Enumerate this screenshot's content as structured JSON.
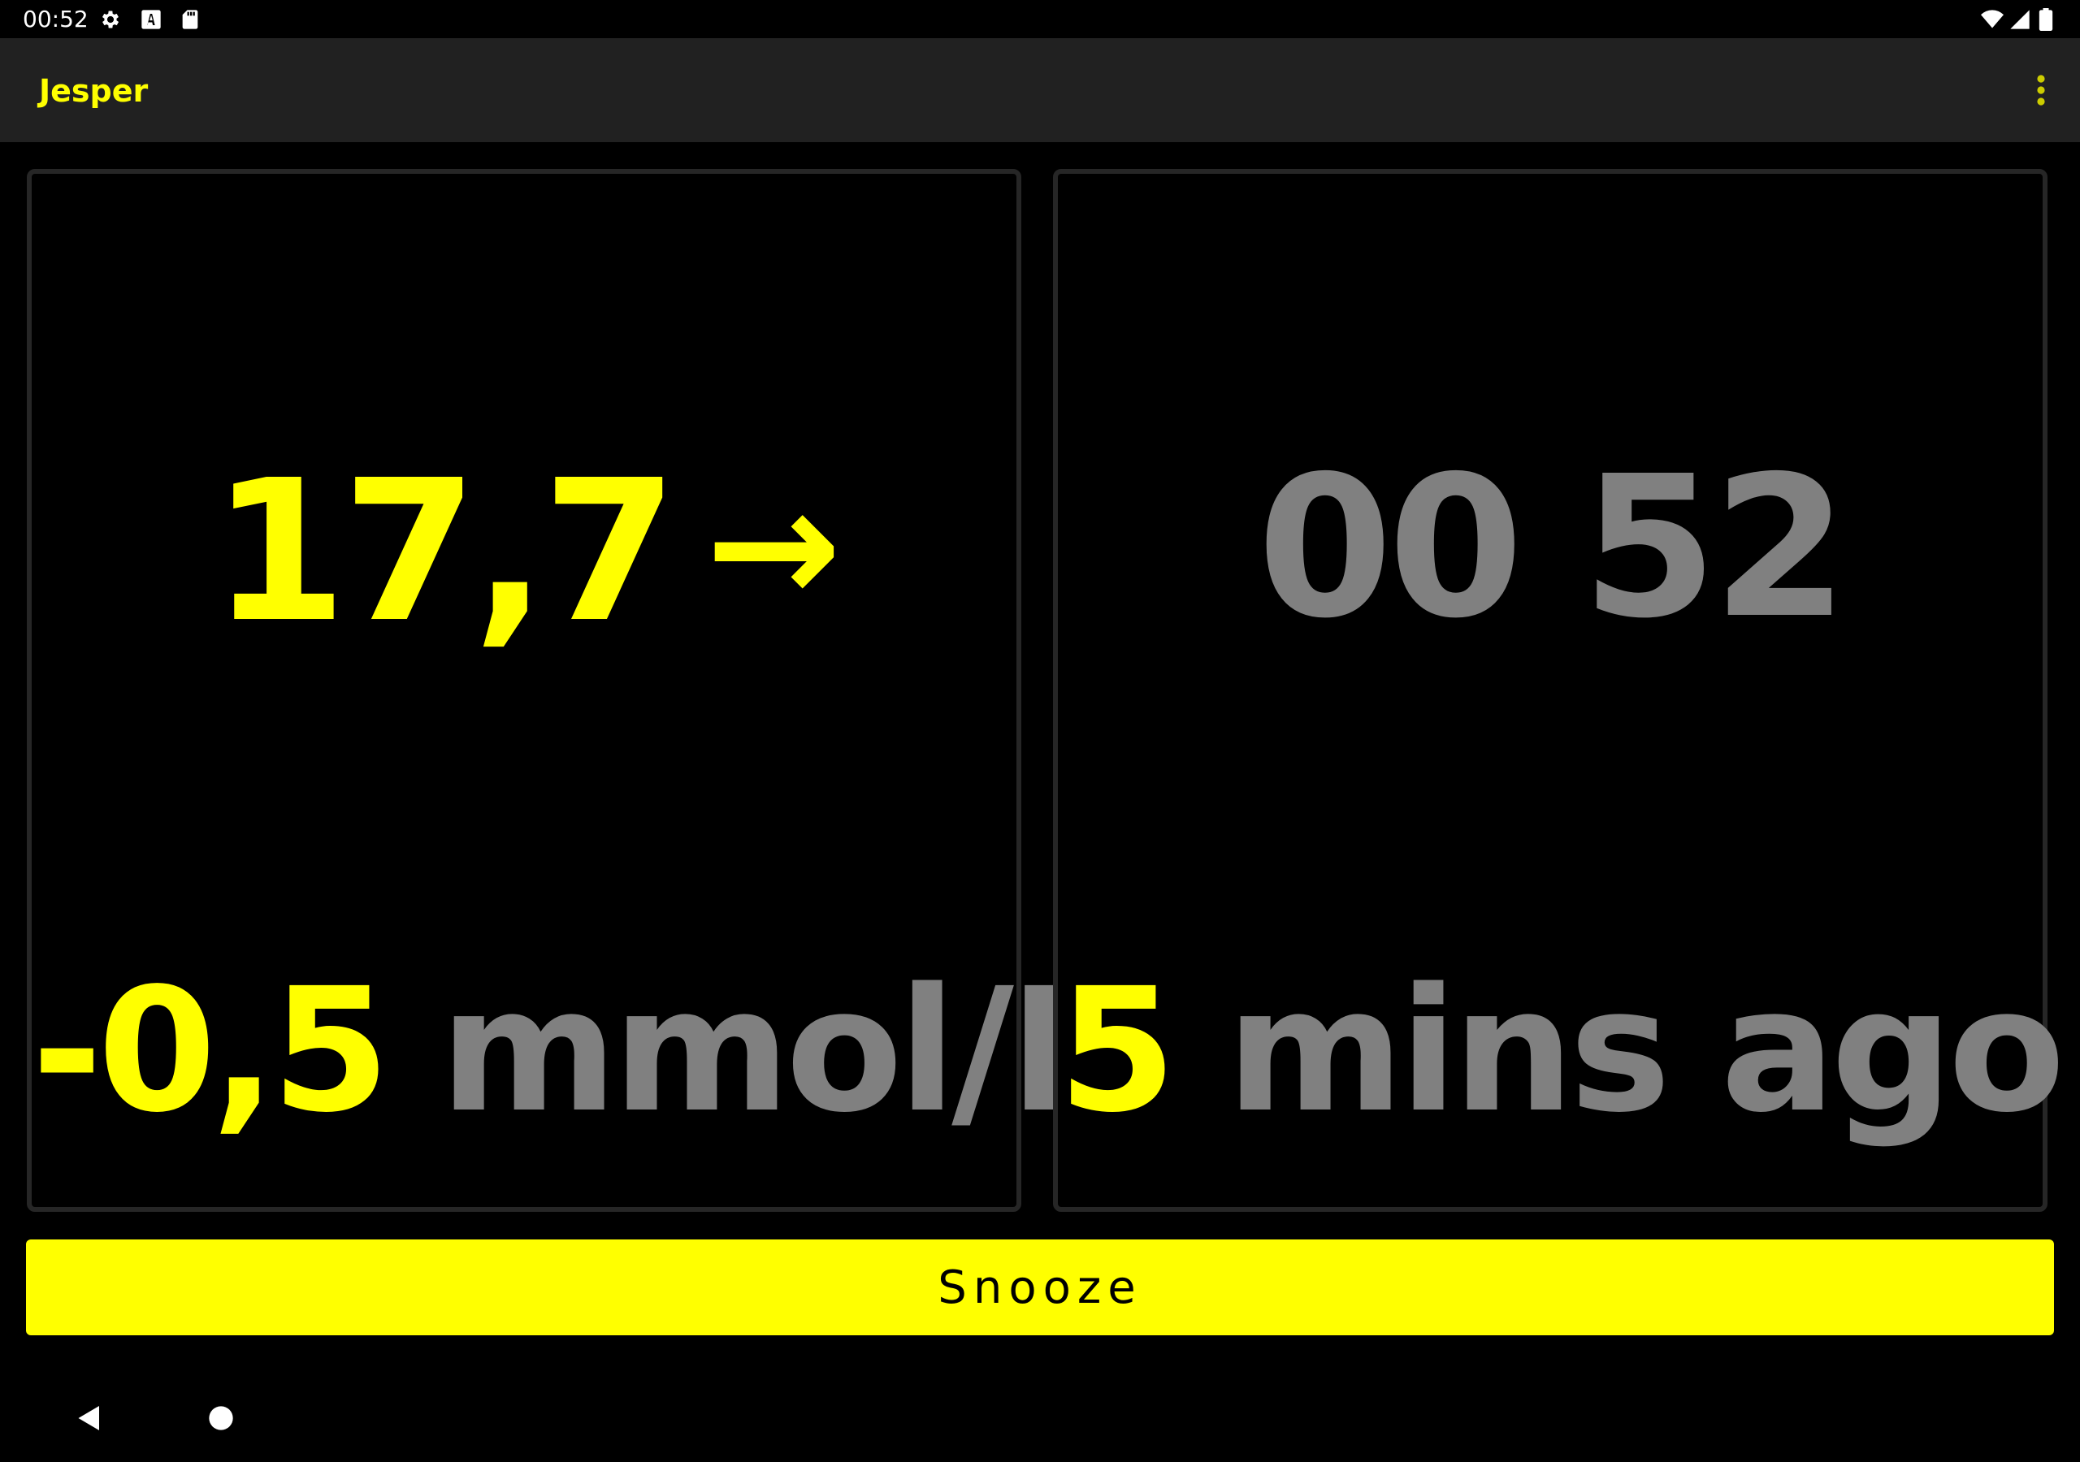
{
  "status_bar": {
    "time": "00:52",
    "icons": [
      "settings-icon",
      "keyboard-a-icon",
      "sd-card-icon",
      "wifi-icon",
      "signal-icon",
      "battery-icon"
    ]
  },
  "app_bar": {
    "title": "Jesper",
    "overflow_icon": "more-vertical-icon"
  },
  "glucose_panel": {
    "value": "17,7",
    "trend_arrow": "→",
    "delta": "-0,5",
    "unit": "mmol/L"
  },
  "time_panel": {
    "clock": "00 52",
    "age_value": "5",
    "age_text": "mins ago"
  },
  "snooze_button": {
    "label": "Snooze"
  },
  "colors": {
    "accent": "#ffff00",
    "secondary_text": "#808080",
    "app_bar_bg": "#212121",
    "background": "#000000",
    "panel_border": "#262626"
  },
  "nav_bar": {
    "icons": [
      "back-icon",
      "home-icon"
    ]
  }
}
